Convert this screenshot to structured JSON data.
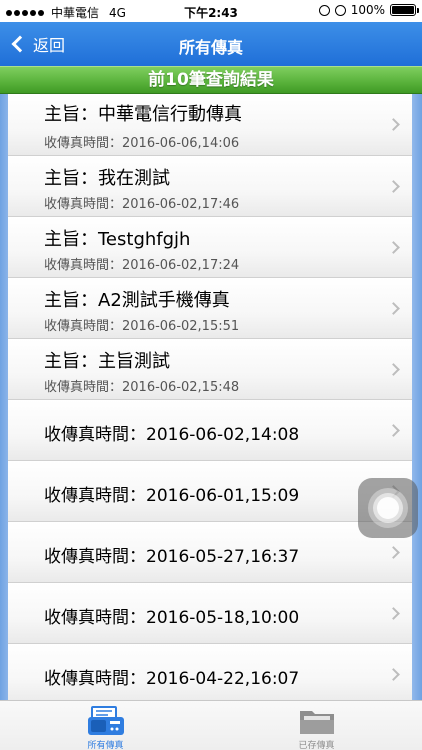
{
  "status_bar": {
    "carrier": "中華電信",
    "network": "4G",
    "time": "下午2:43",
    "battery": "100%"
  },
  "nav": {
    "back_label": "返回",
    "title": "所有傳真"
  },
  "banner": {
    "text": "前10筆查詢結果"
  },
  "list": {
    "items": [
      {
        "subject": "主旨：中華電信行動傳真",
        "time": "收傳真時間：2016-06-06,14:06"
      },
      {
        "subject": "主旨：我在測試",
        "time": "收傳真時間：2016-06-02,17:46"
      },
      {
        "subject": "主旨：Testghfgjh",
        "time": "收傳真時間：2016-06-02,17:24"
      },
      {
        "subject": "主旨：A2測試手機傳真",
        "time": "收傳真時間：2016-06-02,15:51"
      },
      {
        "subject": "主旨：主旨測試",
        "time": "收傳真時間：2016-06-02,15:48"
      },
      {
        "single": "收傳真時間：2016-06-02,14:08"
      },
      {
        "single": "收傳真時間：2016-06-01,15:09"
      },
      {
        "single": "收傳真時間：2016-05-27,16:37"
      },
      {
        "single": "收傳真時間：2016-05-18,10:00"
      },
      {
        "single": "收傳真時間：2016-04-22,16:07"
      }
    ]
  },
  "tabs": {
    "all_fax": {
      "label": "所有傳真",
      "icon": "fax-icon",
      "active": true,
      "color": "#2f7de0"
    },
    "saved_fax": {
      "label": "已存傳真",
      "icon": "folder-icon",
      "active": false,
      "color": "#8e8e8e"
    }
  },
  "colors": {
    "nav_bar": "#1f6fd8",
    "banner": "#58b13a",
    "side_background": "#a9c8f1"
  }
}
